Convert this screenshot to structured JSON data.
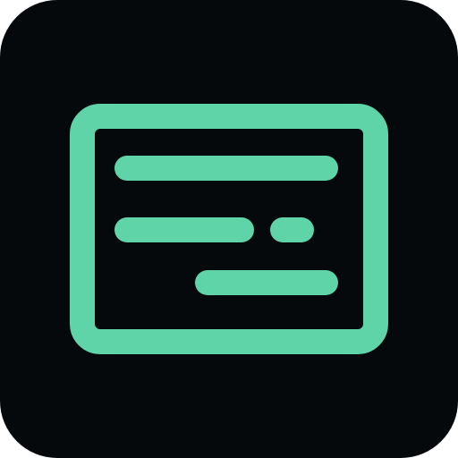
{
  "icon": {
    "name": "subtitles-icon",
    "background_color": "#05090b",
    "stroke_color": "#5fd4a8"
  }
}
